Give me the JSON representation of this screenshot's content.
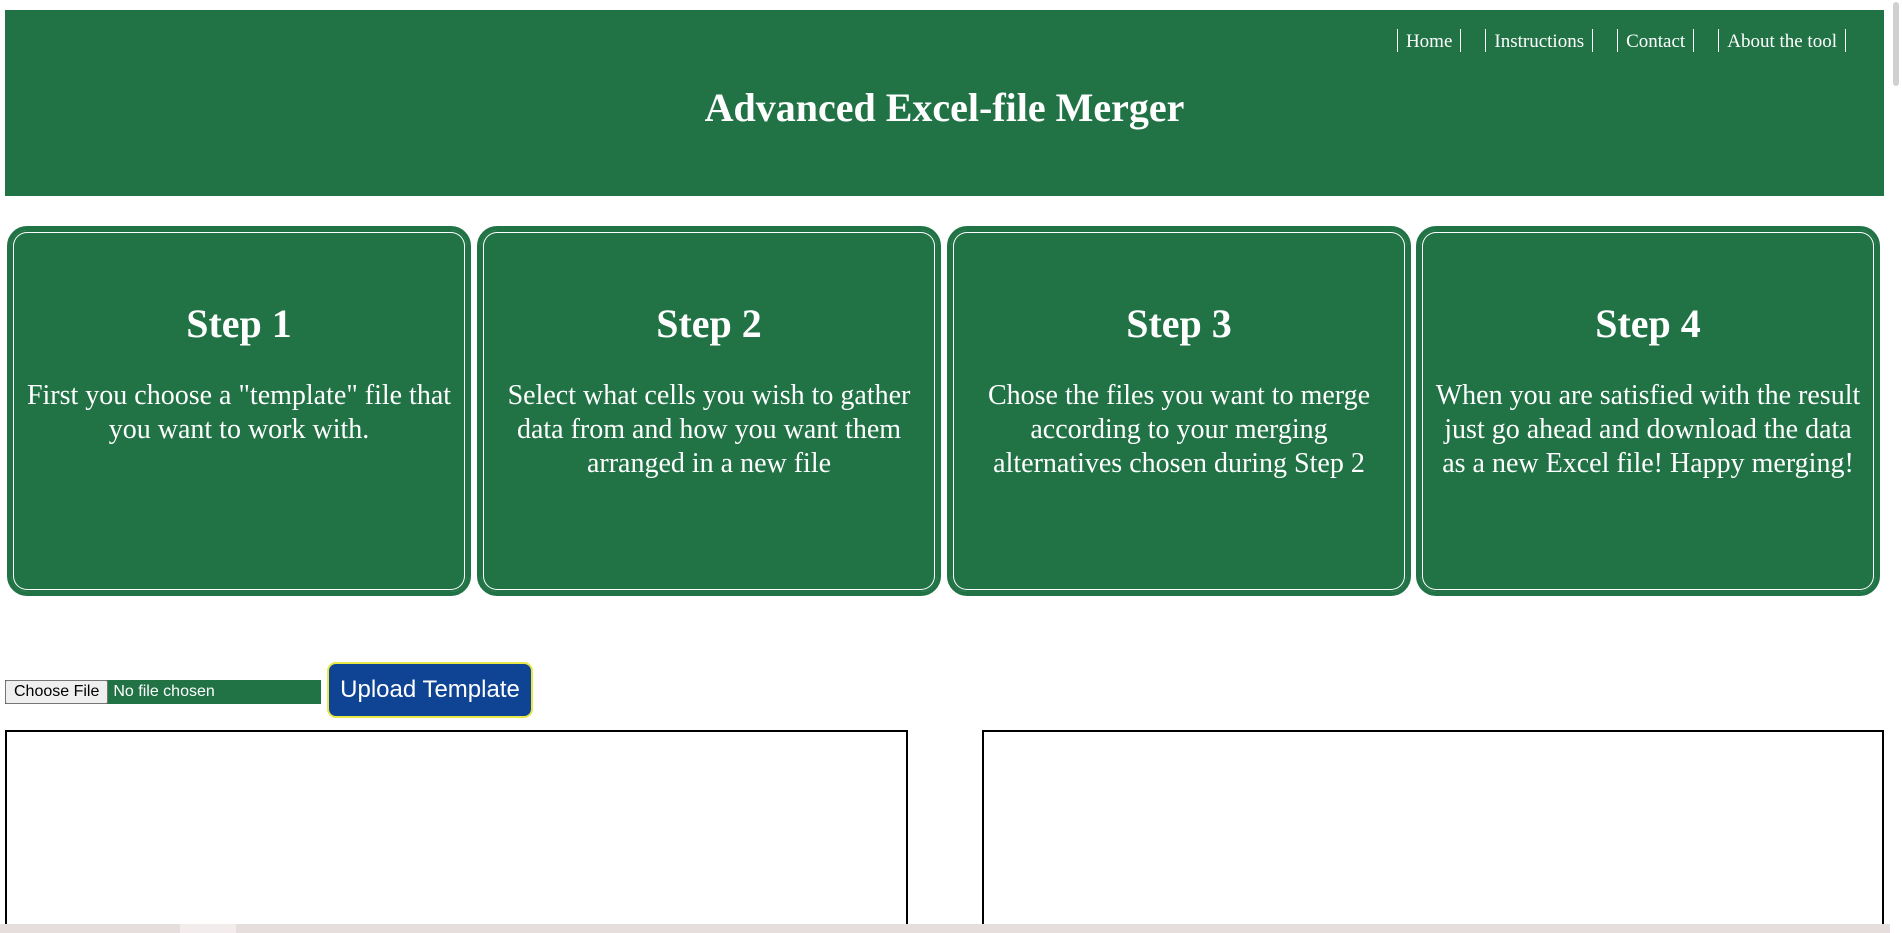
{
  "header": {
    "title": "Advanced Excel-file Merger",
    "nav": [
      "Home",
      "Instructions",
      "Contact",
      "About the tool"
    ]
  },
  "steps": [
    {
      "title": "Step 1",
      "text": "First you choose a \"template\" file that you want to work with."
    },
    {
      "title": "Step 2",
      "text": "Select what cells you wish to gather data from and how you want them arranged in a new file"
    },
    {
      "title": "Step 3",
      "text": "Chose the files you want to merge according to your merging alternatives chosen during Step 2"
    },
    {
      "title": "Step 4",
      "text": "When you are satisfied with the result just go ahead and download the data as a new Excel file! Happy merging!"
    }
  ],
  "upload": {
    "choose_label": "Choose File",
    "file_status": "No file chosen",
    "button_label": "Upload Template"
  },
  "colors": {
    "brand_green": "#217346",
    "upload_button": "#0f4495",
    "upload_button_border": "#e8e84a"
  },
  "icons": []
}
